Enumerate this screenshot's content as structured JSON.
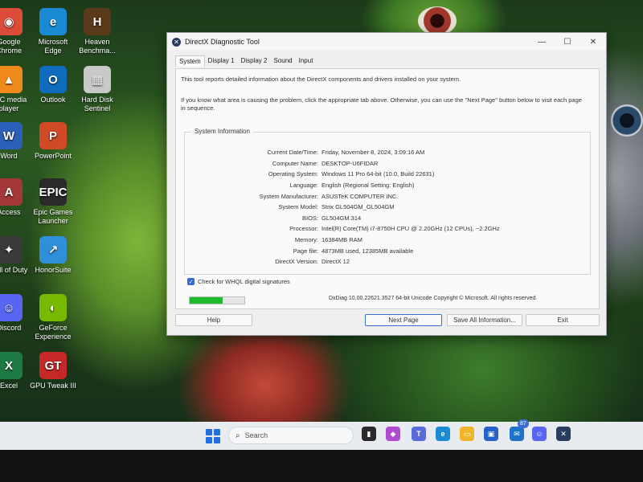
{
  "desktop": {
    "icons": [
      {
        "label": "Google\nChrome",
        "glyph": "◉",
        "color": "#dd4b39"
      },
      {
        "label": "Microsoft\nEdge",
        "glyph": "e",
        "color": "#1a8ad4"
      },
      {
        "label": "Heaven\nBenchma...",
        "glyph": "H",
        "color": "#5a3a1a"
      },
      {
        "label": "VLC media\nplayer",
        "glyph": "▲",
        "color": "#f08a1c"
      },
      {
        "label": "Outlook",
        "glyph": "O",
        "color": "#0f6cbd"
      },
      {
        "label": "Hard Disk\nSentinel",
        "glyph": "▦",
        "color": "#c9c9c9"
      },
      {
        "label": "Word",
        "glyph": "W",
        "color": "#2b5fb8"
      },
      {
        "label": "PowerPoint",
        "glyph": "P",
        "color": "#d04a26"
      },
      {
        "label": "Access",
        "glyph": "A",
        "color": "#a4373a"
      },
      {
        "label": "Epic Games\nLauncher",
        "glyph": "EPIC",
        "color": "#2a2a2a"
      },
      {
        "label": "Call of Duty",
        "glyph": "✦",
        "color": "#3a3a3a"
      },
      {
        "label": "HonorSuite",
        "glyph": "↗",
        "color": "#2f8fd8"
      },
      {
        "label": "Discord",
        "glyph": "☺",
        "color": "#5865f2"
      },
      {
        "label": "GeForce\nExperience",
        "glyph": "◐",
        "color": "#76b900"
      },
      {
        "label": "Excel",
        "glyph": "X",
        "color": "#1d7a45"
      },
      {
        "label": "GPU Tweak III",
        "glyph": "GT",
        "color": "#c62828"
      }
    ]
  },
  "window": {
    "title": "DirectX Diagnostic Tool",
    "controls": {
      "minimize": "—",
      "maximize": "☐",
      "close": "✕"
    },
    "tabs": [
      "System",
      "Display 1",
      "Display 2",
      "Sound",
      "Input"
    ],
    "active_tab": "System",
    "intro_1": "This tool reports detailed information about the DirectX components and drivers installed on your system.",
    "intro_2": "If you know what area is causing the problem, click the appropriate tab above.  Otherwise, you can use the \"Next Page\" button below to visit each page in sequence.",
    "system_info": {
      "legend": "System Information",
      "rows": [
        {
          "label": "Current Date/Time:",
          "value": "Friday, November 8, 2024, 3:09:16 AM"
        },
        {
          "label": "Computer Name:",
          "value": "DESKTOP-U6FIDAR"
        },
        {
          "label": "Operating System:",
          "value": "Windows 11 Pro 64-bit (10.0, Build 22631)"
        },
        {
          "label": "Language:",
          "value": "English (Regional Setting: English)"
        },
        {
          "label": "System Manufacturer:",
          "value": "ASUSTeK COMPUTER INC."
        },
        {
          "label": "System Model:",
          "value": "Strix GL504GM_GL504GM"
        },
        {
          "label": "BIOS:",
          "value": "GL504GM.314"
        },
        {
          "label": "Processor:",
          "value": "Intel(R) Core(TM) i7-8750H CPU @ 2.20GHz (12 CPUs), ~2.2GHz"
        },
        {
          "label": "Memory:",
          "value": "16384MB RAM"
        },
        {
          "label": "Page file:",
          "value": "4873MB used, 12385MB available"
        },
        {
          "label": "DirectX Version:",
          "value": "DirectX 12"
        }
      ]
    },
    "whql_label": "Check for WHQL digital signatures",
    "whql_checked": true,
    "progress_fraction": 0.6,
    "footer": "DxDiag 10.00.22621.3527 64-bit Unicode  Copyright © Microsoft. All rights reserved.",
    "buttons": {
      "help": "Help",
      "next": "Next Page",
      "save": "Save All Information...",
      "exit": "Exit"
    }
  },
  "taskbar": {
    "search_placeholder": "Search",
    "notification_badge": "87"
  }
}
